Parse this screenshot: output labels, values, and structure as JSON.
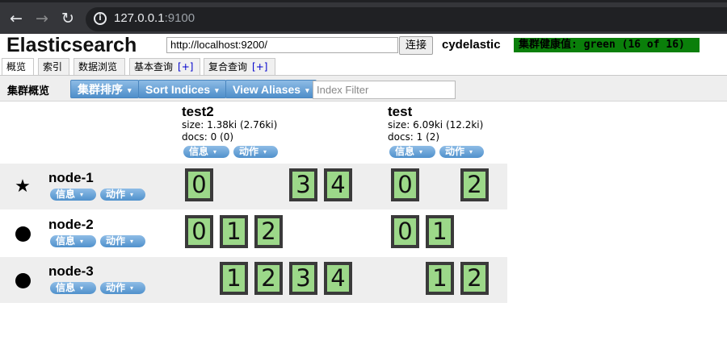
{
  "browser": {
    "url_host": "127.0.0.1",
    "url_port": ":9100",
    "back_glyph": "←",
    "forward_glyph": "→",
    "reload_glyph": "↻",
    "info_glyph": "i"
  },
  "header": {
    "title": "Elasticsearch",
    "connection_url": "http://localhost:9200/",
    "connect_label": "连接",
    "cluster_name": "cydelastic",
    "health_text": "集群健康值: green (16 of 16)",
    "health_color": "#0a7f0a"
  },
  "tabs": [
    {
      "label": "概览",
      "active": true,
      "plus": ""
    },
    {
      "label": "索引",
      "active": false,
      "plus": ""
    },
    {
      "label": "数据浏览",
      "active": false,
      "plus": ""
    },
    {
      "label": "基本查询",
      "active": false,
      "plus": "[+]"
    },
    {
      "label": "复合查询",
      "active": false,
      "plus": "[+]"
    }
  ],
  "toolbar": {
    "title": "集群概览",
    "sort_cluster_label": "集群排序",
    "sort_indices_label": "Sort Indices",
    "view_aliases_label": "View Aliases",
    "index_filter_placeholder": "Index Filter",
    "caret": "▾",
    "accent_color": "#5a96d0"
  },
  "indices": [
    {
      "name": "test2",
      "size": "size: 1.38ki (2.76ki)",
      "docs": "docs: 0 (0)",
      "info_label": "信息",
      "action_label": "动作"
    },
    {
      "name": "test",
      "size": "size: 6.09ki (12.2ki)",
      "docs": "docs: 1 (2)",
      "info_label": "信息",
      "action_label": "动作"
    }
  ],
  "nodes": [
    {
      "name": "node-1",
      "master": true,
      "marker": "★",
      "info_label": "信息",
      "action_label": "动作",
      "test2_shards": [
        "0",
        "",
        "",
        "3",
        "4"
      ],
      "test_shards": [
        "0",
        "",
        "2"
      ]
    },
    {
      "name": "node-2",
      "master": false,
      "marker": "●",
      "info_label": "信息",
      "action_label": "动作",
      "test2_shards": [
        "0",
        "1",
        "2",
        "",
        ""
      ],
      "test_shards": [
        "0",
        "1",
        ""
      ]
    },
    {
      "name": "node-3",
      "master": false,
      "marker": "●",
      "info_label": "信息",
      "action_label": "动作",
      "test2_shards": [
        "",
        "1",
        "2",
        "3",
        "4"
      ],
      "test_shards": [
        "",
        "1",
        "2"
      ]
    }
  ],
  "shard_color": "#9cd889"
}
